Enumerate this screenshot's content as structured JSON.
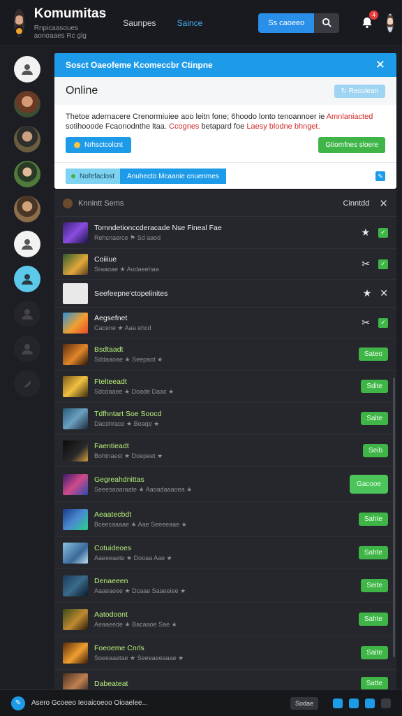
{
  "header": {
    "brand_title": "Komumitas",
    "brand_subtitle": "Rnpicaasoues aonoaaes Rc glg",
    "nav": [
      "Saunpes",
      "Saince"
    ],
    "search_label": "Ss caoeeo",
    "notification_count": "4"
  },
  "panel": {
    "title": "Sosct Oaeofeme Kcomeccbr Ctinpne",
    "online_label": "Online",
    "online_button": "Recolean",
    "description_line1": "Thetoe adernacere Crenormiuiee aoo leitn fone;   6hoodo lonto tenoannoer  ie",
    "description_line1_red": "Amnlaniacted",
    "description_line2": "sotihooode Fcaonodnthe ltaa.",
    "description_line2_red1": "Ccognes",
    "description_line2_mid": "betapard foe",
    "description_line2_red2": "Laesy blodne bhnget.",
    "blue_button": "Nrhsctcolcnt",
    "green_button": "Gtiomfnes sloere",
    "tag_a": "Nofefaclost",
    "tag_b": "Anuhecto Mcaanie cnuenmes"
  },
  "list": {
    "header_title": "Knnintt Sems",
    "header_right": "Cinntdd",
    "rows": [
      {
        "title": "Tomndetionccderacade Nse Fineal Fae",
        "meta": "Rehcnaerce ⚑ Sd aaod",
        "action": "tools"
      },
      {
        "title": "Coiiiue",
        "meta": "Sraaoae ★ Aodaeehaa",
        "action": "tools"
      },
      {
        "title": "Seefeepne'ctopelinites",
        "meta": "",
        "action": "tools"
      },
      {
        "title": "Aegsefnet",
        "meta": "Cacene ★ Aaa ehcd",
        "action": "tools"
      },
      {
        "title": "Bsdtaadt",
        "meta": "Sddaaoae ★ Seepaot ★",
        "action": "Sateo"
      },
      {
        "title": "Ftelteeadt",
        "meta": "Sdcoaaee ★ Doade Daac ★",
        "action": "Sdite"
      },
      {
        "title": "Tdfhntart Soe Soocd",
        "meta": "Dacohrace ★ Beaqe ★",
        "action": "Salte"
      },
      {
        "title": "Faentieadt",
        "meta": "Bohtnaest ★ Doepeet ★",
        "action": "Seib"
      },
      {
        "title": "Gegreahdnittas",
        "meta": "Seeesaoaraate ★ Aaoadaaaoea ★",
        "action": "Gacooe"
      },
      {
        "title": "Aeaatecbdt",
        "meta": "Bceecaaaae ★ Aae Seeeeaae ★",
        "action": "Sahte"
      },
      {
        "title": "Cotuideoes",
        "meta": "Aaeeeaete ★ Dooaa Aae ★",
        "action": "Sahte"
      },
      {
        "title": "Denaeeen",
        "meta": "Aaaeaeee ★ Dcaae Saaeeiee ★",
        "action": "Seite"
      },
      {
        "title": "Aatodoont",
        "meta": "Aeaaeede ★ Bacaaoe Sae ★",
        "action": "Sahte"
      },
      {
        "title": "Foeoeme Cnrls",
        "meta": "Soeeaaetae ★ Seeeaeeaaae ★",
        "action": "Saite"
      },
      {
        "title": "Dabeateat",
        "meta": "",
        "action": "Satte"
      }
    ]
  },
  "footer": {
    "text": "Asero Gcoeeo Ieoaicoeoo Oioaelee...",
    "button": "Sodae"
  },
  "colors": {
    "accent_blue": "#1e9be8",
    "accent_green": "#3fb548",
    "bg_dark": "#1d1e23"
  }
}
